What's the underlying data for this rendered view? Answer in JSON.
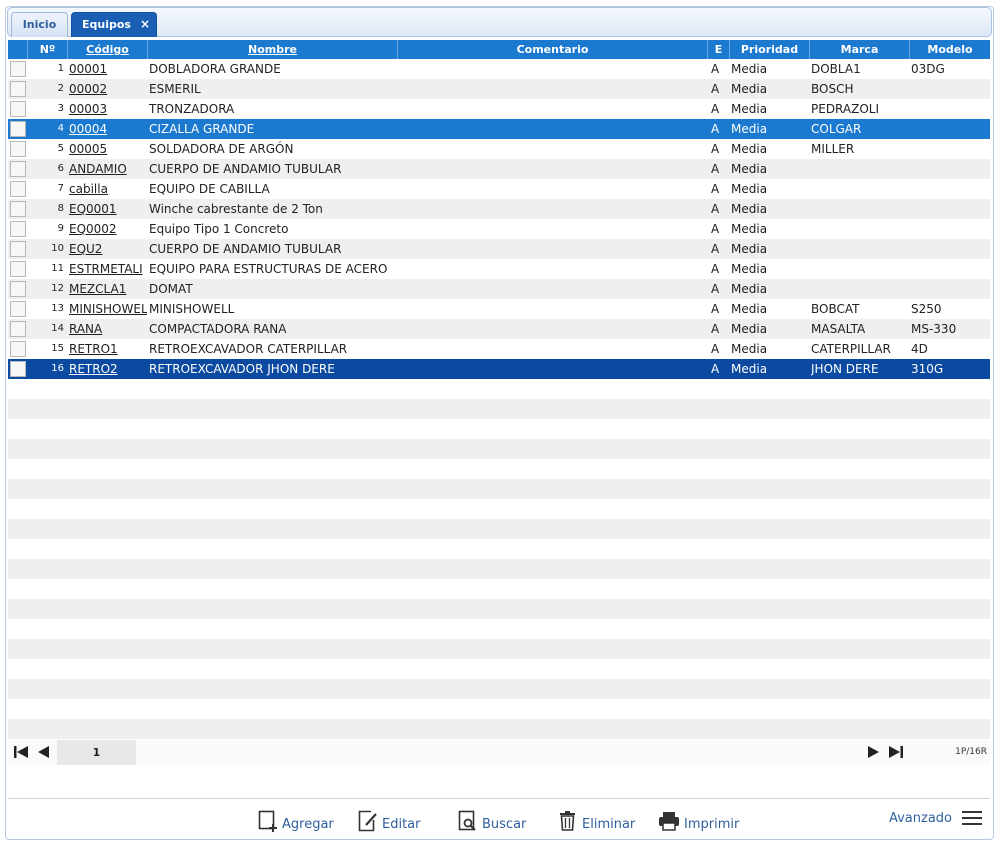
{
  "tabs": [
    {
      "label": "Inicio"
    },
    {
      "label": "Equipos",
      "close": "×"
    }
  ],
  "grid": {
    "headers": {
      "num": "Nº",
      "codigo": "Código",
      "nombre": "Nombre",
      "comentario": "Comentario",
      "e": "E",
      "prioridad": "Prioridad",
      "marca": "Marca",
      "modelo": "Modelo"
    },
    "rows": [
      {
        "n": "1",
        "codigo": "00001",
        "nombre": "DOBLADORA GRANDE",
        "comentario": "",
        "e": "A",
        "prioridad": "Media",
        "marca": "DOBLA1",
        "modelo": "03DG"
      },
      {
        "n": "2",
        "codigo": "00002",
        "nombre": "ESMERIL",
        "comentario": "",
        "e": "A",
        "prioridad": "Media",
        "marca": "BOSCH",
        "modelo": ""
      },
      {
        "n": "3",
        "codigo": "00003",
        "nombre": "TRONZADORA",
        "comentario": "",
        "e": "A",
        "prioridad": "Media",
        "marca": "PEDRAZOLI",
        "modelo": ""
      },
      {
        "n": "4",
        "codigo": "00004",
        "nombre": "CIZALLA GRANDE",
        "comentario": "",
        "e": "A",
        "prioridad": "Media",
        "marca": "COLGAR",
        "modelo": ""
      },
      {
        "n": "5",
        "codigo": "00005",
        "nombre": "SOLDADORA DE ARGÓN",
        "comentario": "",
        "e": "A",
        "prioridad": "Media",
        "marca": "MILLER",
        "modelo": ""
      },
      {
        "n": "6",
        "codigo": "ANDAMIO",
        "nombre": "CUERPO DE ANDAMIO TUBULAR",
        "comentario": "",
        "e": "A",
        "prioridad": "Media",
        "marca": "",
        "modelo": ""
      },
      {
        "n": "7",
        "codigo": "cabilla",
        "nombre": "EQUIPO DE CABILLA",
        "comentario": "",
        "e": "A",
        "prioridad": "Media",
        "marca": "",
        "modelo": ""
      },
      {
        "n": "8",
        "codigo": "EQ0001",
        "nombre": "Winche cabrestante de 2 Ton",
        "comentario": "",
        "e": "A",
        "prioridad": "Media",
        "marca": "",
        "modelo": ""
      },
      {
        "n": "9",
        "codigo": "EQ0002",
        "nombre": "Equipo Tipo 1 Concreto",
        "comentario": "",
        "e": "A",
        "prioridad": "Media",
        "marca": "",
        "modelo": ""
      },
      {
        "n": "10",
        "codigo": "EQU2",
        "nombre": "CUERPO DE ANDAMIO TUBULAR",
        "comentario": "",
        "e": "A",
        "prioridad": "Media",
        "marca": "",
        "modelo": ""
      },
      {
        "n": "11",
        "codigo": "ESTRMETALI",
        "nombre": "EQUIPO PARA ESTRUCTURAS DE ACERO",
        "comentario": "",
        "e": "A",
        "prioridad": "Media",
        "marca": "",
        "modelo": ""
      },
      {
        "n": "12",
        "codigo": "MEZCLA1",
        "nombre": "DOMAT",
        "comentario": "",
        "e": "A",
        "prioridad": "Media",
        "marca": "",
        "modelo": ""
      },
      {
        "n": "13",
        "codigo": "MINISHOWEL",
        "nombre": "MINISHOWELL",
        "comentario": "",
        "e": "A",
        "prioridad": "Media",
        "marca": "BOBCAT",
        "modelo": "S250"
      },
      {
        "n": "14",
        "codigo": "RANA",
        "nombre": "COMPACTADORA RANA",
        "comentario": "",
        "e": "A",
        "prioridad": "Media",
        "marca": "MASALTA",
        "modelo": "MS-330"
      },
      {
        "n": "15",
        "codigo": "RETRO1",
        "nombre": "RETROEXCAVADOR CATERPILLAR",
        "comentario": "",
        "e": "A",
        "prioridad": "Media",
        "marca": "CATERPILLAR",
        "modelo": "4D"
      },
      {
        "n": "16",
        "codigo": "RETRO2",
        "nombre": "RETROEXCAVADOR JHON DERE",
        "comentario": "",
        "e": "A",
        "prioridad": "Media",
        "marca": "JHON DERE",
        "modelo": "310G"
      }
    ]
  },
  "pager": {
    "page": "1",
    "info": "1P/16R"
  },
  "toolbar": {
    "agregar": "Agregar",
    "editar": "Editar",
    "buscar": "Buscar",
    "eliminar": "Eliminar",
    "imprimir": "Imprimir",
    "avanzado": "Avanzado"
  },
  "colors": {
    "header": "#1c79d0",
    "selected_light": "#1c79d0",
    "selected_dark": "#0b4aa0",
    "link": "#2f5f9e"
  }
}
